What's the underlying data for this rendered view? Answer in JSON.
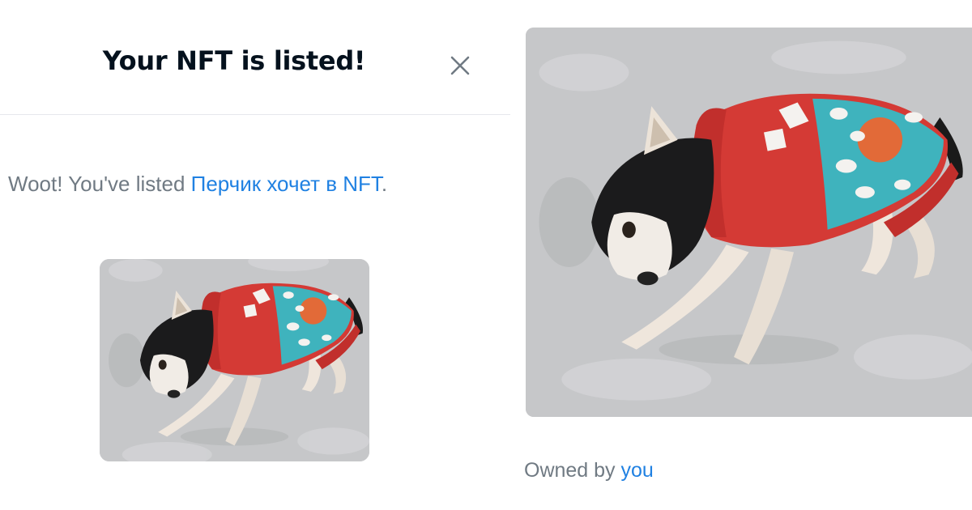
{
  "modal": {
    "title": "Your NFT is listed!",
    "close_icon": "close-icon",
    "message_prefix": "Woot! You've listed ",
    "nft_name": "Перчик хочет в NFT",
    "message_suffix": "."
  },
  "preview": {
    "image_icon": "dog-in-sweater-image"
  },
  "ownership": {
    "owned_by_label": "Owned by",
    "owner": "you"
  },
  "colors": {
    "title": "#04111d",
    "muted_text": "#707a83",
    "link": "#2081e2",
    "divider": "#e6e8ec"
  }
}
